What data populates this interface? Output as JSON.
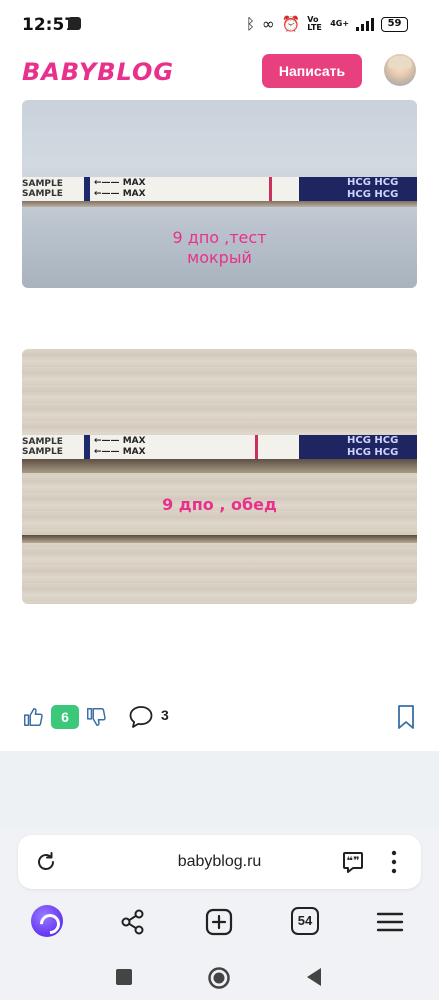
{
  "status_bar": {
    "time": "12:57",
    "net_label": "4G+",
    "volte_label": "Vo LTE",
    "battery": "59"
  },
  "header": {
    "logo": "BABYBLOG",
    "write_button": "Написать"
  },
  "post": {
    "photos": [
      {
        "caption_line1": "9 дпо ,тест",
        "caption_line2": "мокрый",
        "strip_sample": "SAMPLE",
        "strip_max": "MAX",
        "strip_hcg": "HCG"
      },
      {
        "caption_line1": "9 дпо , обед",
        "strip_sample": "SAMPLE",
        "strip_max": "MAX",
        "strip_hcg": "HCG"
      }
    ],
    "likes": "6",
    "comments": "3"
  },
  "browser": {
    "url": "babyblog.ru",
    "tabs_count": "54"
  },
  "colors": {
    "brand": "#e8318c",
    "button": "#e8407f",
    "like_badge": "#3cc87a",
    "alice": "#6a3ef5"
  }
}
